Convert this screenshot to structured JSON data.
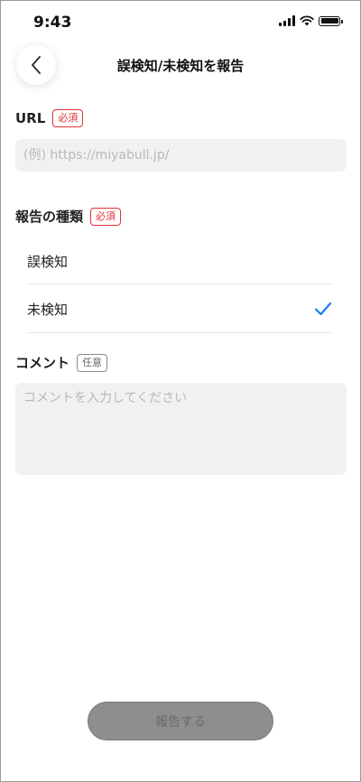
{
  "status_bar": {
    "time": "9:43"
  },
  "header": {
    "title": "誤検知/未検知を報告"
  },
  "url_section": {
    "label": "URL",
    "required_badge": "必須",
    "placeholder": "(例) https://miyabull.jp/"
  },
  "report_type_section": {
    "label": "報告の種類",
    "required_badge": "必須",
    "options": [
      {
        "label": "誤検知",
        "selected": false
      },
      {
        "label": "未検知",
        "selected": true
      }
    ]
  },
  "comment_section": {
    "label": "コメント",
    "optional_badge": "任意",
    "placeholder": "コメントを入力してください"
  },
  "submit": {
    "label": "報告する"
  },
  "colors": {
    "required": "#e0303a",
    "check": "#1a7df0",
    "field_bg": "#f1f1f1",
    "button_disabled": "#8e8e8e"
  }
}
